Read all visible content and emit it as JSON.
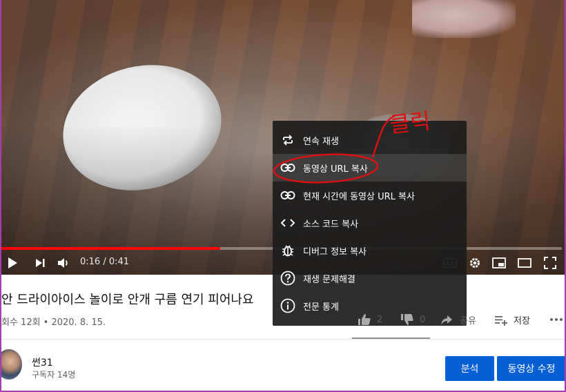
{
  "player": {
    "progress_fraction": 0.39,
    "time": "0:16 / 0:41"
  },
  "context_menu": {
    "items": [
      {
        "label": "연속 재생",
        "icon": "loop-icon"
      },
      {
        "label": "동영상 URL 복사",
        "icon": "link-icon"
      },
      {
        "label": "현재 시간에 동영상 URL 복사",
        "icon": "link-icon"
      },
      {
        "label": "소스 코드 복사",
        "icon": "code-icon"
      },
      {
        "label": "디버그 정보 복사",
        "icon": "bug-icon"
      },
      {
        "label": "재생 문제해결",
        "icon": "help-icon"
      },
      {
        "label": "전문 통계",
        "icon": "info-icon"
      }
    ],
    "hovered_index": 1
  },
  "annotation": {
    "text": "클릭",
    "color": "#e01010"
  },
  "video_info": {
    "title": "안 드라이아이스 놀이로 안개 구름 연기 피어나요",
    "meta": "회수 12회 • 2020. 8. 15.",
    "likes": "2",
    "dislikes": "0",
    "share_label": "공유",
    "save_label": "저장"
  },
  "channel": {
    "name": "썬31",
    "subscribers": "구독자 14명"
  },
  "buttons": {
    "analytics": "분석",
    "edit": "동영상 수정"
  },
  "colors": {
    "accent": "#065fd4",
    "progress": "#ff0000"
  }
}
